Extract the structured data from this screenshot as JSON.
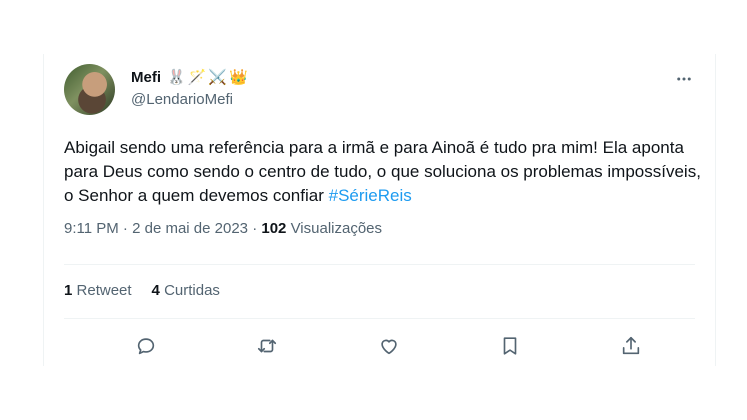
{
  "user": {
    "name": "Mefi",
    "emojis": "🐰🪄⚔️👑",
    "handle": "@LendarioMefi"
  },
  "tweet": {
    "text": "Abigail sendo uma referência para a irmã e para Ainoã é tudo pra mim! Ela aponta para Deus como sendo o centro de tudo, o que soluciona os problemas impossíveis, o Senhor a quem devemos confiar ",
    "hashtag": "#SérieReis"
  },
  "meta": {
    "time": "9:11 PM",
    "date": "2 de mai de 2023",
    "views_count": "102",
    "views_label": "Visualizações"
  },
  "stats": {
    "retweets_count": "1",
    "retweets_label": "Retweet",
    "likes_count": "4",
    "likes_label": "Curtidas"
  },
  "icons": {
    "more": "more-horizontal-icon",
    "reply": "reply-icon",
    "retweet": "retweet-icon",
    "like": "heart-icon",
    "bookmark": "bookmark-icon",
    "share": "share-icon"
  },
  "colors": {
    "accent": "#1d9bf0",
    "secondary_text": "#536471"
  }
}
